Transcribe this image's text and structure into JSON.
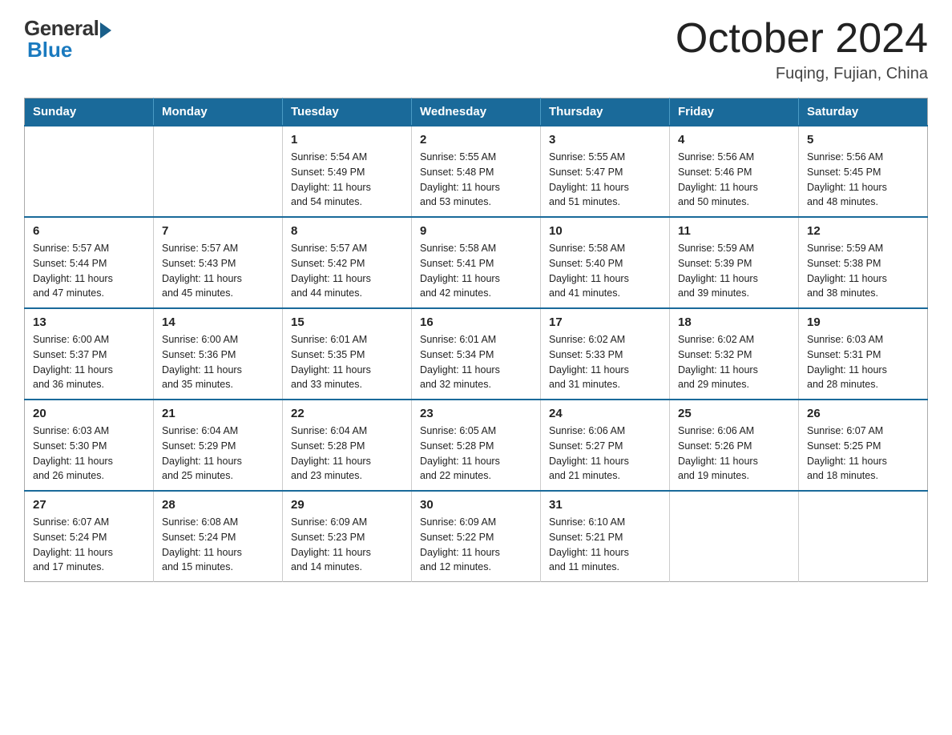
{
  "logo": {
    "general": "General",
    "blue": "Blue"
  },
  "header": {
    "month": "October 2024",
    "location": "Fuqing, Fujian, China"
  },
  "weekdays": [
    "Sunday",
    "Monday",
    "Tuesday",
    "Wednesday",
    "Thursday",
    "Friday",
    "Saturday"
  ],
  "weeks": [
    [
      {
        "day": "",
        "info": ""
      },
      {
        "day": "",
        "info": ""
      },
      {
        "day": "1",
        "info": "Sunrise: 5:54 AM\nSunset: 5:49 PM\nDaylight: 11 hours\nand 54 minutes."
      },
      {
        "day": "2",
        "info": "Sunrise: 5:55 AM\nSunset: 5:48 PM\nDaylight: 11 hours\nand 53 minutes."
      },
      {
        "day": "3",
        "info": "Sunrise: 5:55 AM\nSunset: 5:47 PM\nDaylight: 11 hours\nand 51 minutes."
      },
      {
        "day": "4",
        "info": "Sunrise: 5:56 AM\nSunset: 5:46 PM\nDaylight: 11 hours\nand 50 minutes."
      },
      {
        "day": "5",
        "info": "Sunrise: 5:56 AM\nSunset: 5:45 PM\nDaylight: 11 hours\nand 48 minutes."
      }
    ],
    [
      {
        "day": "6",
        "info": "Sunrise: 5:57 AM\nSunset: 5:44 PM\nDaylight: 11 hours\nand 47 minutes."
      },
      {
        "day": "7",
        "info": "Sunrise: 5:57 AM\nSunset: 5:43 PM\nDaylight: 11 hours\nand 45 minutes."
      },
      {
        "day": "8",
        "info": "Sunrise: 5:57 AM\nSunset: 5:42 PM\nDaylight: 11 hours\nand 44 minutes."
      },
      {
        "day": "9",
        "info": "Sunrise: 5:58 AM\nSunset: 5:41 PM\nDaylight: 11 hours\nand 42 minutes."
      },
      {
        "day": "10",
        "info": "Sunrise: 5:58 AM\nSunset: 5:40 PM\nDaylight: 11 hours\nand 41 minutes."
      },
      {
        "day": "11",
        "info": "Sunrise: 5:59 AM\nSunset: 5:39 PM\nDaylight: 11 hours\nand 39 minutes."
      },
      {
        "day": "12",
        "info": "Sunrise: 5:59 AM\nSunset: 5:38 PM\nDaylight: 11 hours\nand 38 minutes."
      }
    ],
    [
      {
        "day": "13",
        "info": "Sunrise: 6:00 AM\nSunset: 5:37 PM\nDaylight: 11 hours\nand 36 minutes."
      },
      {
        "day": "14",
        "info": "Sunrise: 6:00 AM\nSunset: 5:36 PM\nDaylight: 11 hours\nand 35 minutes."
      },
      {
        "day": "15",
        "info": "Sunrise: 6:01 AM\nSunset: 5:35 PM\nDaylight: 11 hours\nand 33 minutes."
      },
      {
        "day": "16",
        "info": "Sunrise: 6:01 AM\nSunset: 5:34 PM\nDaylight: 11 hours\nand 32 minutes."
      },
      {
        "day": "17",
        "info": "Sunrise: 6:02 AM\nSunset: 5:33 PM\nDaylight: 11 hours\nand 31 minutes."
      },
      {
        "day": "18",
        "info": "Sunrise: 6:02 AM\nSunset: 5:32 PM\nDaylight: 11 hours\nand 29 minutes."
      },
      {
        "day": "19",
        "info": "Sunrise: 6:03 AM\nSunset: 5:31 PM\nDaylight: 11 hours\nand 28 minutes."
      }
    ],
    [
      {
        "day": "20",
        "info": "Sunrise: 6:03 AM\nSunset: 5:30 PM\nDaylight: 11 hours\nand 26 minutes."
      },
      {
        "day": "21",
        "info": "Sunrise: 6:04 AM\nSunset: 5:29 PM\nDaylight: 11 hours\nand 25 minutes."
      },
      {
        "day": "22",
        "info": "Sunrise: 6:04 AM\nSunset: 5:28 PM\nDaylight: 11 hours\nand 23 minutes."
      },
      {
        "day": "23",
        "info": "Sunrise: 6:05 AM\nSunset: 5:28 PM\nDaylight: 11 hours\nand 22 minutes."
      },
      {
        "day": "24",
        "info": "Sunrise: 6:06 AM\nSunset: 5:27 PM\nDaylight: 11 hours\nand 21 minutes."
      },
      {
        "day": "25",
        "info": "Sunrise: 6:06 AM\nSunset: 5:26 PM\nDaylight: 11 hours\nand 19 minutes."
      },
      {
        "day": "26",
        "info": "Sunrise: 6:07 AM\nSunset: 5:25 PM\nDaylight: 11 hours\nand 18 minutes."
      }
    ],
    [
      {
        "day": "27",
        "info": "Sunrise: 6:07 AM\nSunset: 5:24 PM\nDaylight: 11 hours\nand 17 minutes."
      },
      {
        "day": "28",
        "info": "Sunrise: 6:08 AM\nSunset: 5:24 PM\nDaylight: 11 hours\nand 15 minutes."
      },
      {
        "day": "29",
        "info": "Sunrise: 6:09 AM\nSunset: 5:23 PM\nDaylight: 11 hours\nand 14 minutes."
      },
      {
        "day": "30",
        "info": "Sunrise: 6:09 AM\nSunset: 5:22 PM\nDaylight: 11 hours\nand 12 minutes."
      },
      {
        "day": "31",
        "info": "Sunrise: 6:10 AM\nSunset: 5:21 PM\nDaylight: 11 hours\nand 11 minutes."
      },
      {
        "day": "",
        "info": ""
      },
      {
        "day": "",
        "info": ""
      }
    ]
  ]
}
